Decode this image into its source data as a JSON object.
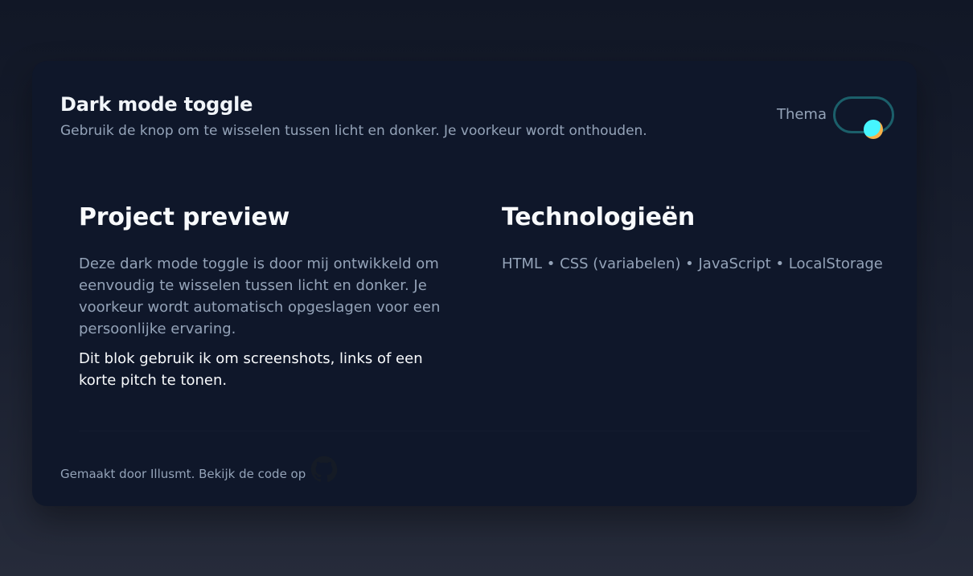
{
  "header": {
    "title": "Dark mode toggle",
    "subtitle": "Gebruik de knop om te wisselen tussen licht en donker. Je voorkeur wordt onthouden."
  },
  "theme_control": {
    "label": "Thema",
    "state": "on",
    "track_color": "#667085",
    "border_color": "#1b5f6a",
    "knob_colors": [
      "#46f5ff",
      "#f7b24a"
    ]
  },
  "project_preview": {
    "title": "Project preview",
    "description": "Deze dark mode toggle is door mij ontwikkeld om eenvoudig te wisselen tussen licht en donker. Je voorkeur wordt automatisch opgeslagen voor een persoonlijke ervaring.",
    "note": "Dit blok gebruik ik om screenshots, links of een korte pitch te tonen."
  },
  "technologies": {
    "title": "Technologieën",
    "list": "HTML • CSS (variabelen) • JavaScript • LocalStorage"
  },
  "footer": {
    "text": "Gemaakt door Illusmt. Bekijk de code op",
    "icon": "github-icon"
  },
  "colors": {
    "background": "#111726",
    "card": "#0f172a",
    "text_primary": "#f1f5f9",
    "text_muted": "#94a3b8"
  }
}
